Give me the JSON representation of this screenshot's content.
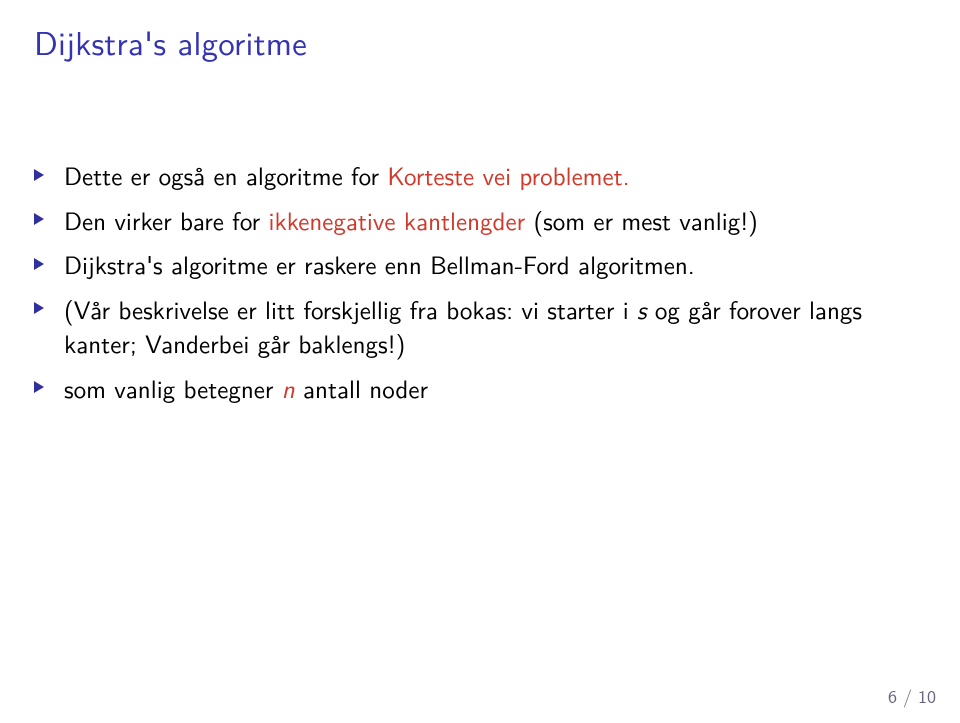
{
  "title": "Dijkstra's algoritme",
  "items": [
    {
      "pre": "Dette er også en algoritme for ",
      "hl": "Korteste vei problemet.",
      "post": ""
    },
    {
      "pre": "Den  virker bare for ",
      "hl": "ikkenegative kantlengder",
      "post": " (som er mest vanlig!)"
    },
    {
      "pre": "Dijkstra's algoritme er raskere enn Bellman-Ford algoritmen.",
      "hl": "",
      "post": ""
    },
    {
      "pre": "(Vår beskrivelse er litt forskjellig fra bokas: vi starter i ",
      "ital_in": "s",
      "post_in": " og går forover langs kanter; Vanderbei går baklengs!)"
    },
    {
      "pre": "som vanlig betegner ",
      "hl": "n",
      "post": " antall noder"
    }
  ],
  "footer": "6 / 10"
}
